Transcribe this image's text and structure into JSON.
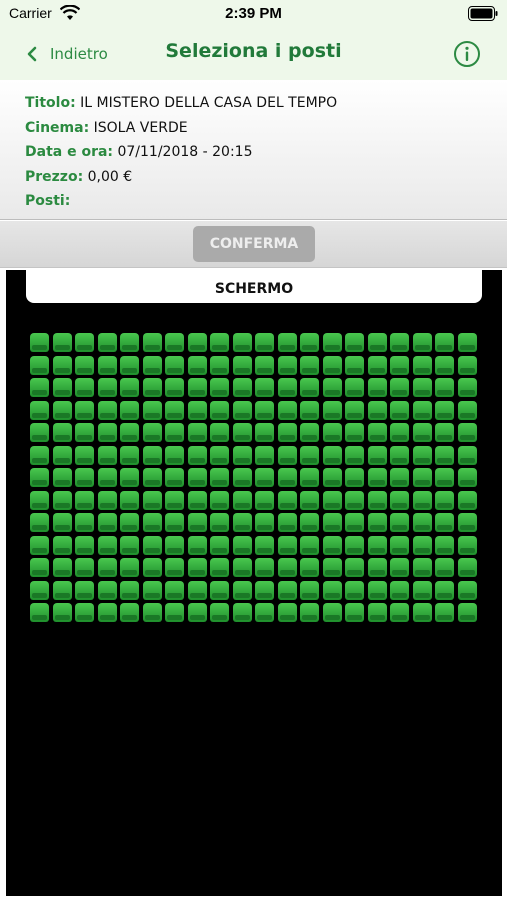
{
  "status_bar": {
    "carrier": "Carrier",
    "time": "2:39 PM"
  },
  "nav": {
    "back_label": "Indietro",
    "title": "Seleziona i posti",
    "info_icon": "info-icon"
  },
  "info": {
    "title_label": "Titolo:",
    "title_value": "IL MISTERO DELLA CASA DEL TEMPO",
    "cinema_label": "Cinema:",
    "cinema_value": "ISOLA VERDE",
    "datetime_label": "Data e ora:",
    "datetime_value": "07/11/2018 - 20:15",
    "price_label": "Prezzo:",
    "price_value": "0,00 €",
    "seats_label": "Posti:",
    "seats_value": ""
  },
  "confirm_label": "CONFERMA",
  "seatmap": {
    "screen_label": "SCHERMO",
    "rows": 13,
    "cols": 20,
    "seat_color": "#3fb84a",
    "background": "#000000"
  },
  "colors": {
    "accent": "#2c8a43",
    "nav_bg": "#eef8ea",
    "button_disabled": "#aaaaaa"
  }
}
